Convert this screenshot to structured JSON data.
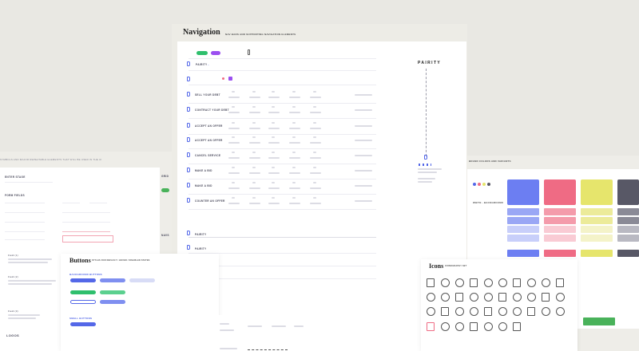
{
  "navigation": {
    "title": "Navigation",
    "subtitle": "NAV BARS AND SUPPORTING NAVIGATION ELEMENTS",
    "brand": "PAIRITY",
    "brand_side": "PAIRITY",
    "rows": [
      "SELL YOUR DEBT",
      "CONTRACT YOUR DEBT",
      "ACCEPT AN OFFER",
      "ACCEPT AN OFFER",
      "CANCEL SERVICE",
      "MAKE A BID",
      "MAKE A BID",
      "COUNTER AN OFFER"
    ],
    "bottom_rows": [
      "PAIRITY",
      "PAIRITY",
      "",
      "",
      "",
      ""
    ]
  },
  "left_panel": {
    "header": "SYMBOLS AND MAJOR REPEATABLE ELEMENTS THAT WILL BE USED IN THE UI",
    "section_a": "ENTER STAGE",
    "section_b": "FORM FIELDS",
    "section_c": "GRID",
    "section_d": "NAVS",
    "section_e": "LOGOS",
    "field_labels": [
      "Field (1)",
      "Field (2)",
      "Field (3)"
    ]
  },
  "colors_panel": {
    "header": "BRAND COLORS AND VARIANTS",
    "label": "WHITE · BACKGROUND",
    "swatches": [
      {
        "name": "CORN",
        "hex": "#6c7ef2",
        "light": "#9aa7f5",
        "lighter": "#c8cffa"
      },
      {
        "name": "CORAL",
        "hex": "#ef6b84",
        "light": "#f49bab",
        "lighter": "#f9cbd4"
      },
      {
        "name": "LEMON",
        "hex": "#e6e56c",
        "light": "#eceb9a",
        "lighter": "#f4f3c9"
      },
      {
        "name": "DARK",
        "hex": "#585866",
        "light": "#8a8a96",
        "lighter": "#b9b9c2"
      }
    ],
    "dots": [
      "#5468e8",
      "#ef6b84",
      "#e6e56c",
      "#585866"
    ]
  },
  "buttons": {
    "title": "Buttons",
    "subtitle": "STYLES FOR DEFAULT / HOVER / DISABLED STATES",
    "sec1": "BACKGROUND BUTTONS",
    "sec2": "SMALL BUTTONS"
  },
  "icons": {
    "title": "Icons",
    "subtitle": "ICONOGRAPHY SET"
  }
}
